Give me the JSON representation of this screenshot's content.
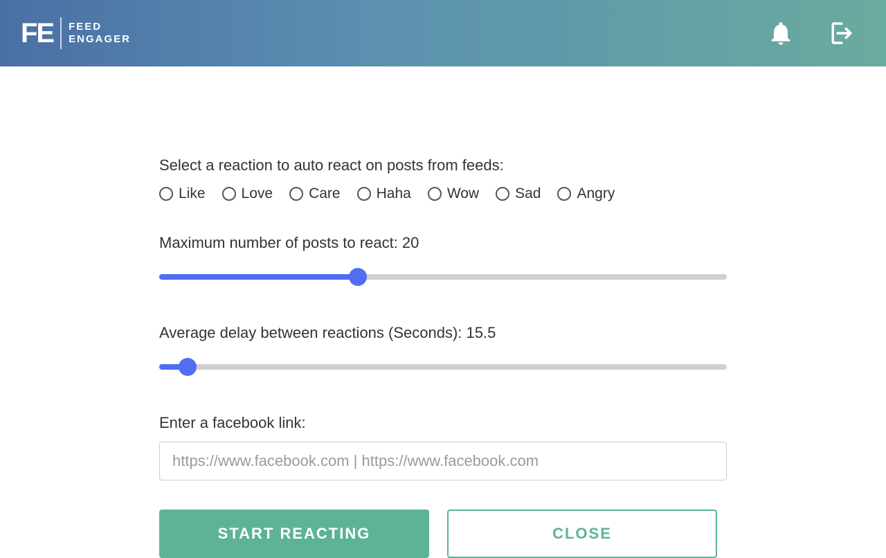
{
  "header": {
    "logo_abbrev": "FE",
    "logo_line1": "FEED",
    "logo_line2": "ENGAGER"
  },
  "reaction_section": {
    "label": "Select a reaction to auto react on posts from feeds:",
    "options": [
      "Like",
      "Love",
      "Care",
      "Haha",
      "Wow",
      "Sad",
      "Angry"
    ]
  },
  "max_posts": {
    "label_prefix": "Maximum number of posts to react: ",
    "value": "20",
    "fill_percent": 35
  },
  "delay": {
    "label_prefix": "Average delay between reactions (Seconds): ",
    "value": "15.5",
    "fill_percent": 5
  },
  "link_section": {
    "label": "Enter a facebook link:",
    "placeholder": "https://www.facebook.com | https://www.facebook.com"
  },
  "buttons": {
    "start": "START REACTING",
    "close": "CLOSE"
  }
}
